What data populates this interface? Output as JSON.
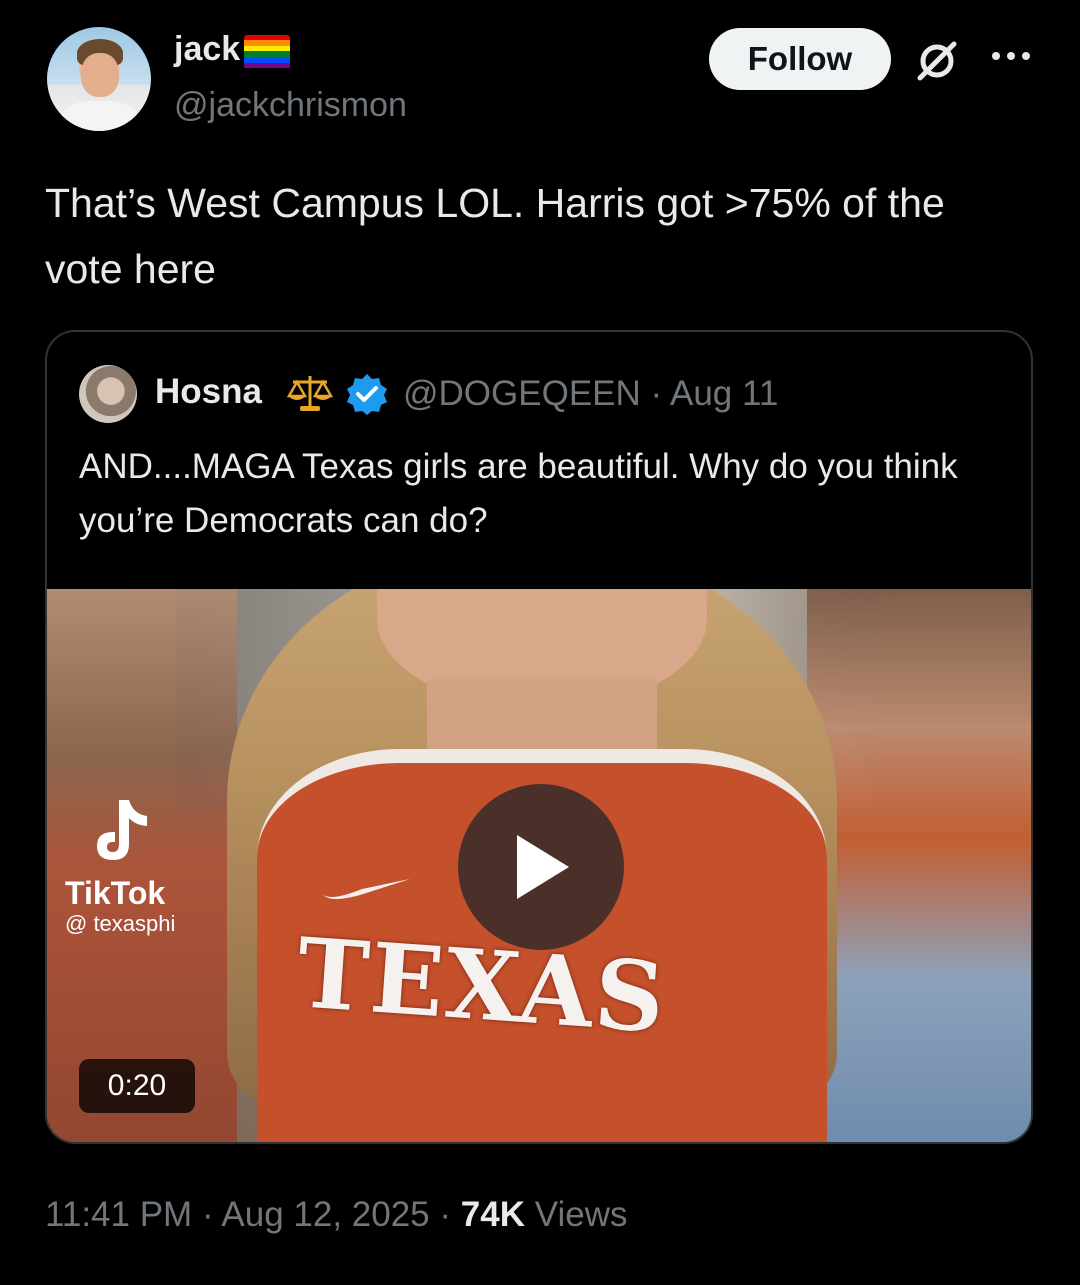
{
  "author": {
    "display_name": "jack",
    "handle": "@jackchrismon",
    "avatar_icon": "profile-photo",
    "name_badge_icon": "rainbow-flag-icon"
  },
  "actions": {
    "follow_label": "Follow",
    "grok_icon": "grok-icon",
    "more_icon": "more-options-icon"
  },
  "tweet": {
    "text": "That’s West Campus LOL. Harris got >75% of the vote here"
  },
  "quoted_tweet": {
    "display_name": "Hosna",
    "name_emoji_icon": "balance-scale-icon",
    "verified_icon": "verified-badge-icon",
    "handle": "@DOGEQEEN",
    "separator": "·",
    "date": "Aug 11",
    "text": "AND....MAGA Texas girls are beautiful. Why do you think you’re Democrats can do?",
    "media": {
      "watermark_brand": "TikTok",
      "watermark_user": "@ texasphi",
      "jersey_text": "TEXAS",
      "duration": "0:20",
      "play_icon": "play-icon"
    }
  },
  "meta": {
    "time": "11:41 PM",
    "separator1": "·",
    "date": "Aug 12, 2025",
    "separator2": "·",
    "views_count": "74K",
    "views_label": "Views"
  },
  "colors": {
    "background": "#000000",
    "text_primary": "#e7e9ea",
    "text_secondary": "#71767b",
    "border": "#2f3336",
    "follow_bg": "#eff3f4",
    "verified_blue": "#1d9bf0"
  }
}
